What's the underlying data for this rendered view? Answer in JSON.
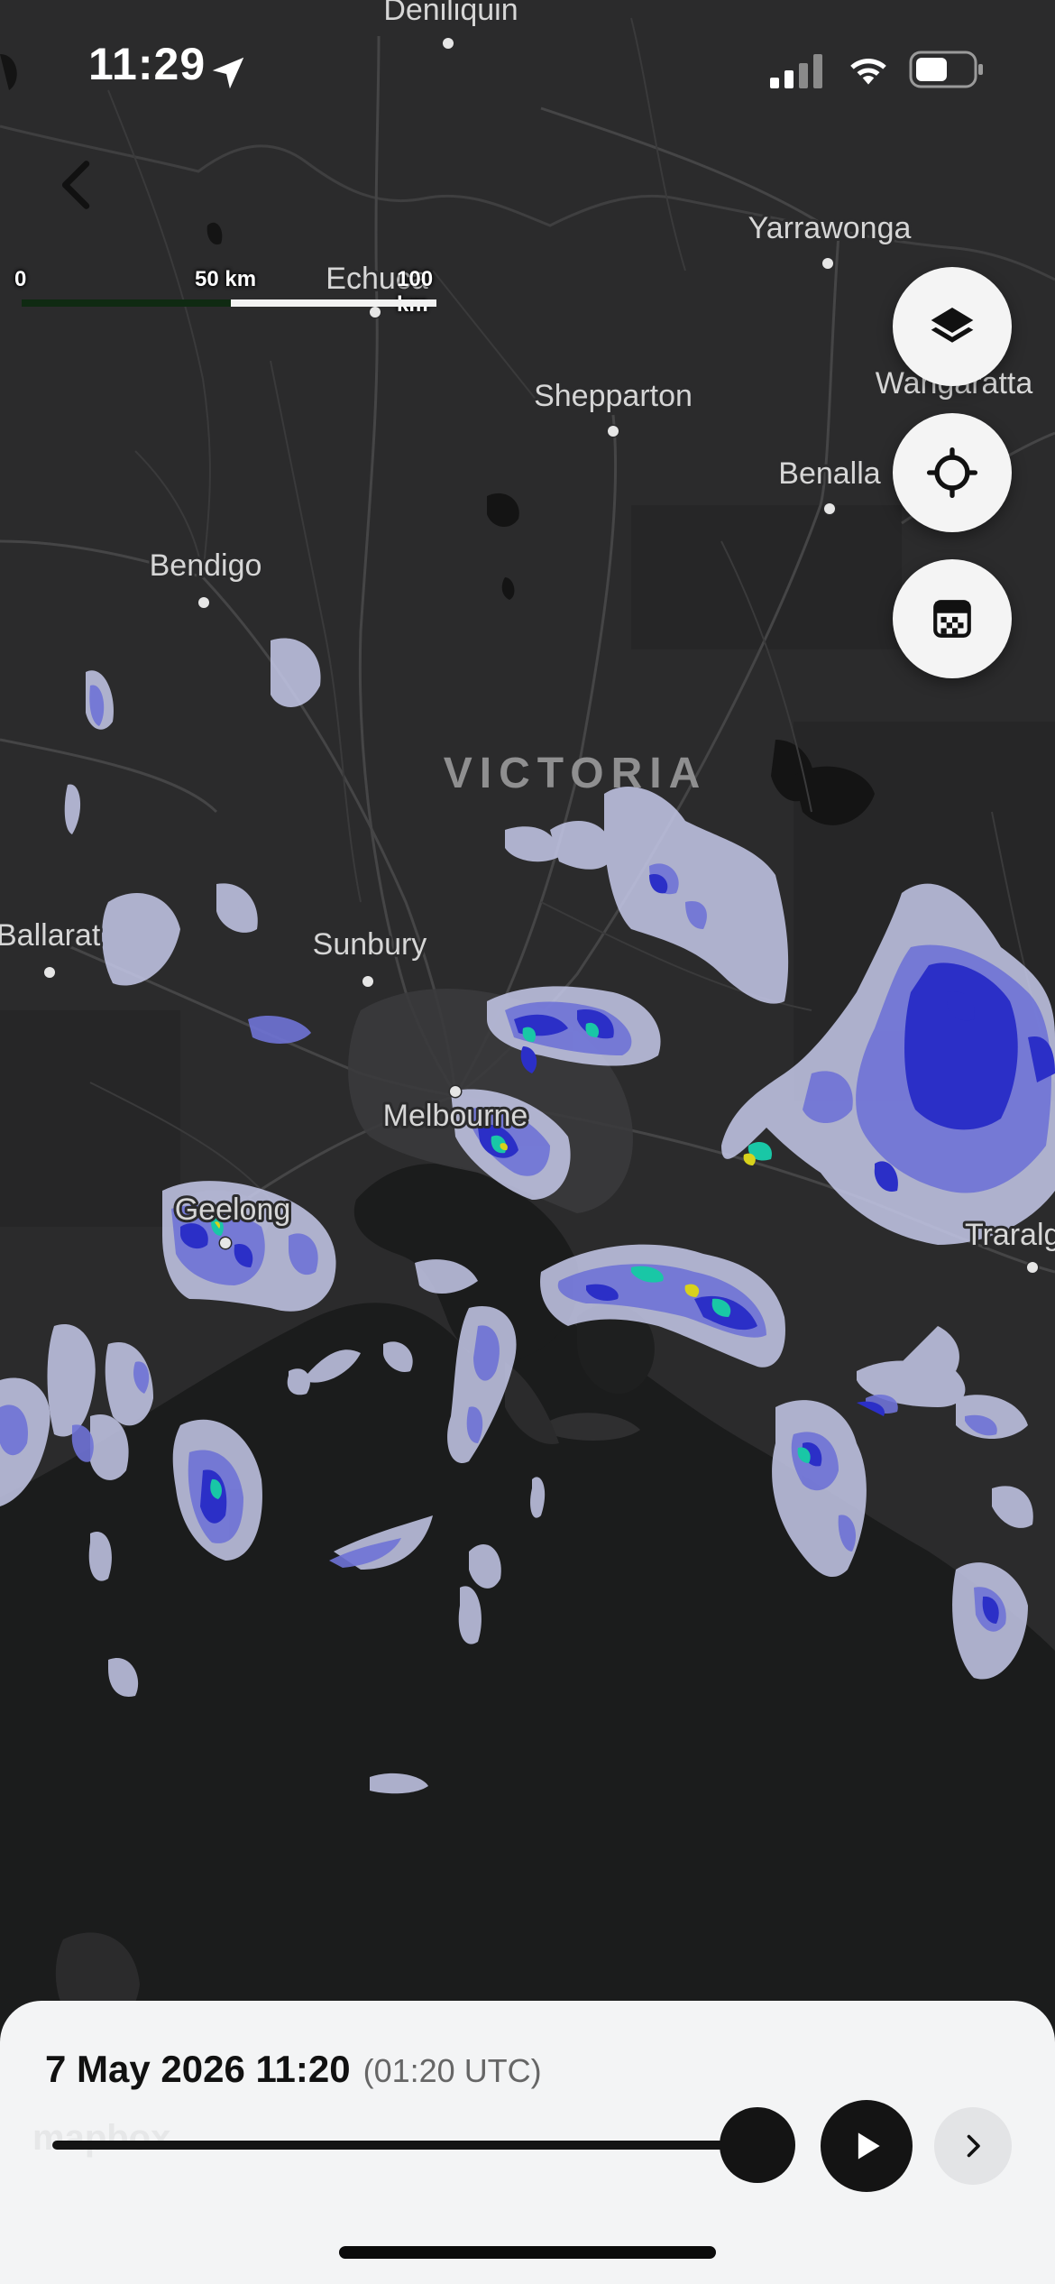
{
  "status_bar": {
    "time": "11:29"
  },
  "map": {
    "region_label": "VICTORIA",
    "places": [
      {
        "name": "Deniliquin"
      },
      {
        "name": "Yarrawonga"
      },
      {
        "name": "Echuca"
      },
      {
        "name": "Wangaratta"
      },
      {
        "name": "Shepparton"
      },
      {
        "name": "Benalla"
      },
      {
        "name": "Bendigo"
      },
      {
        "name": "Ballarat"
      },
      {
        "name": "Sunbury"
      },
      {
        "name": "Melbourne"
      },
      {
        "name": "Geelong"
      },
      {
        "name": "Traralgon"
      }
    ],
    "scale": {
      "zero": "0",
      "mid": "50 km",
      "max": "100 km"
    },
    "attribution": "mapbox"
  },
  "controls": {
    "layers_icon": "layers-icon",
    "locate_icon": "crosshair-icon",
    "legend_icon": "color-legend-icon",
    "back_icon": "chevron-left-icon"
  },
  "timeline": {
    "date": "7 May 2026 11:20",
    "utc": "(01:20 UTC)",
    "progress": 1.0
  },
  "colors": {
    "map_land": "#2b2b2c",
    "map_sea": "#1b1c1c",
    "rain_light": "#c6c9ea",
    "rain_moderate": "#6f73d6",
    "rain_heavy": "#2b2fc7",
    "rain_very_heavy": "#19c7a6",
    "rain_extreme": "#d8d21c"
  }
}
